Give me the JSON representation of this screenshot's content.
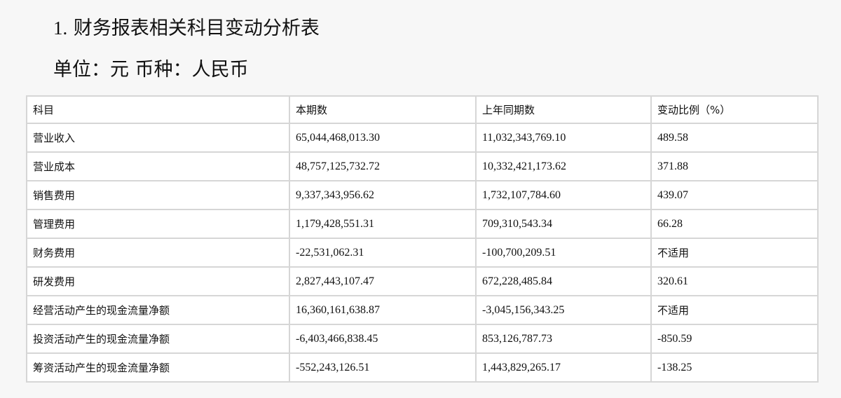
{
  "doc": {
    "title_number": "1.",
    "title_text": "财务报表相关科目变动分析表",
    "unit_line": "单位：元 币种：人民币"
  },
  "table": {
    "headers": [
      "科目",
      "本期数",
      "上年同期数",
      "变动比例（%）"
    ],
    "rows": [
      [
        "营业收入",
        "65,044,468,013.30",
        "11,032,343,769.10",
        "489.58"
      ],
      [
        "营业成本",
        "48,757,125,732.72",
        "10,332,421,173.62",
        "371.88"
      ],
      [
        "销售费用",
        "9,337,343,956.62",
        "1,732,107,784.60",
        "439.07"
      ],
      [
        "管理费用",
        "1,179,428,551.31",
        "709,310,543.34",
        "66.28"
      ],
      [
        "财务费用",
        "-22,531,062.31",
        "-100,700,209.51",
        "不适用"
      ],
      [
        "研发费用",
        "2,827,443,107.47",
        "672,228,485.84",
        "320.61"
      ],
      [
        "经营活动产生的现金流量净额",
        "16,360,161,638.87",
        "-3,045,156,343.25",
        "不适用"
      ],
      [
        "投资活动产生的现金流量净额",
        "-6,403,466,838.45",
        "853,126,787.73",
        "-850.59"
      ],
      [
        "筹资活动产生的现金流量净额",
        "-552,243,126.51",
        "1,443,829,265.17",
        "-138.25"
      ]
    ]
  }
}
